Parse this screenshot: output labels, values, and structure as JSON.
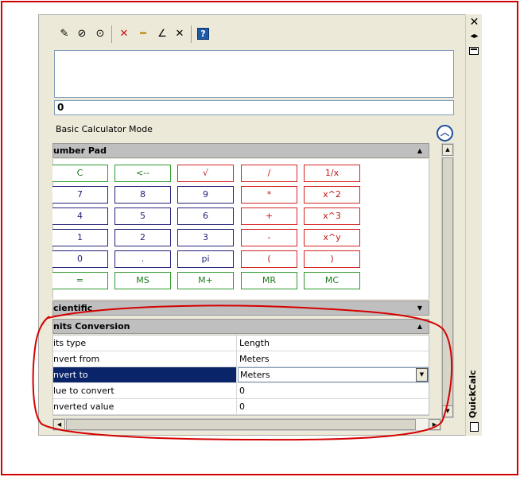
{
  "palette": {
    "title": "QuickCalc",
    "close_glyph": "✕",
    "autohide_glyph": "◂▸"
  },
  "toolbar": {
    "tools": [
      {
        "name": "clear-tool",
        "glyph": "✎"
      },
      {
        "name": "clear-history-tool",
        "glyph": "⊘"
      },
      {
        "name": "paste-value-tool",
        "glyph": "⊙"
      },
      {
        "name": "get-coordinates-tool",
        "glyph": "✕"
      },
      {
        "name": "distance-tool",
        "glyph": "━"
      },
      {
        "name": "angle-tool",
        "glyph": "∠"
      },
      {
        "name": "intersection-tool",
        "glyph": "✕"
      },
      {
        "name": "help-tool",
        "glyph": "?"
      }
    ]
  },
  "calculator": {
    "input_value": "0",
    "mode_label": "Basic Calculator Mode"
  },
  "number_pad": {
    "header": "umber Pad",
    "rows": [
      [
        {
          "l": "C",
          "c": "green"
        },
        {
          "l": "<--",
          "c": "green"
        },
        {
          "l": "√",
          "c": "red"
        },
        {
          "l": "/",
          "c": "red"
        },
        {
          "l": "1/x",
          "c": "red"
        }
      ],
      [
        {
          "l": "7",
          "c": "blue"
        },
        {
          "l": "8",
          "c": "blue"
        },
        {
          "l": "9",
          "c": "blue"
        },
        {
          "l": "*",
          "c": "red"
        },
        {
          "l": "x^2",
          "c": "red"
        }
      ],
      [
        {
          "l": "4",
          "c": "blue"
        },
        {
          "l": "5",
          "c": "blue"
        },
        {
          "l": "6",
          "c": "blue"
        },
        {
          "l": "+",
          "c": "red"
        },
        {
          "l": "x^3",
          "c": "red"
        }
      ],
      [
        {
          "l": "1",
          "c": "blue"
        },
        {
          "l": "2",
          "c": "blue"
        },
        {
          "l": "3",
          "c": "blue"
        },
        {
          "l": "-",
          "c": "red"
        },
        {
          "l": "x^y",
          "c": "red"
        }
      ],
      [
        {
          "l": "0",
          "c": "blue"
        },
        {
          "l": ".",
          "c": "blue"
        },
        {
          "l": "pi",
          "c": "blue"
        },
        {
          "l": "(",
          "c": "red"
        },
        {
          "l": ")",
          "c": "red"
        }
      ],
      [
        {
          "l": "=",
          "c": "green"
        },
        {
          "l": "MS",
          "c": "green"
        },
        {
          "l": "M+",
          "c": "green"
        },
        {
          "l": "MR",
          "c": "green"
        },
        {
          "l": "MC",
          "c": "green"
        }
      ]
    ]
  },
  "scientific": {
    "header": "cientific"
  },
  "units_conversion": {
    "header": "nits Conversion",
    "rows": [
      {
        "name": "its type",
        "value": "Length"
      },
      {
        "name": "nvert from",
        "value": "Meters"
      },
      {
        "name": "nvert to",
        "value": "Meters"
      },
      {
        "name": "lue to convert",
        "value": "0"
      },
      {
        "name": "nverted value",
        "value": "0"
      }
    ]
  },
  "colors": {
    "annotation": "#d40000",
    "selection": "#0a246a",
    "key_green": "#2e9b2e",
    "key_blue": "#23237a",
    "key_red": "#d42424"
  }
}
